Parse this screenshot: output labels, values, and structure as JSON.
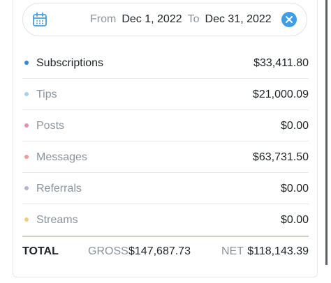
{
  "date_filter": {
    "from_label": "From",
    "from_value": "Dec 1, 2022",
    "to_label": "To",
    "to_value": "Dec 31, 2022",
    "calendar_icon": "calendar-icon",
    "clear_icon": "close-icon",
    "accent_color": "#3f9ee8"
  },
  "rows": [
    {
      "label": "Subscriptions",
      "value": "$33,411.80",
      "dot_color": "#2f86dd"
    },
    {
      "label": "Tips",
      "value": "$21,000.09",
      "dot_color": "#9fd3ee"
    },
    {
      "label": "Posts",
      "value": "$0.00",
      "dot_color": "#e690aa"
    },
    {
      "label": "Messages",
      "value": "$63,731.50",
      "dot_color": "#ee9d95"
    },
    {
      "label": "Referrals",
      "value": "$0.00",
      "dot_color": "#b6b1d9"
    },
    {
      "label": "Streams",
      "value": "$0.00",
      "dot_color": "#f3cd7e"
    }
  ],
  "totals": {
    "label": "TOTAL",
    "gross_label": "GROSS",
    "gross_value": "$147,687.73",
    "net_label": "NET",
    "net_value": "$118,143.39"
  }
}
